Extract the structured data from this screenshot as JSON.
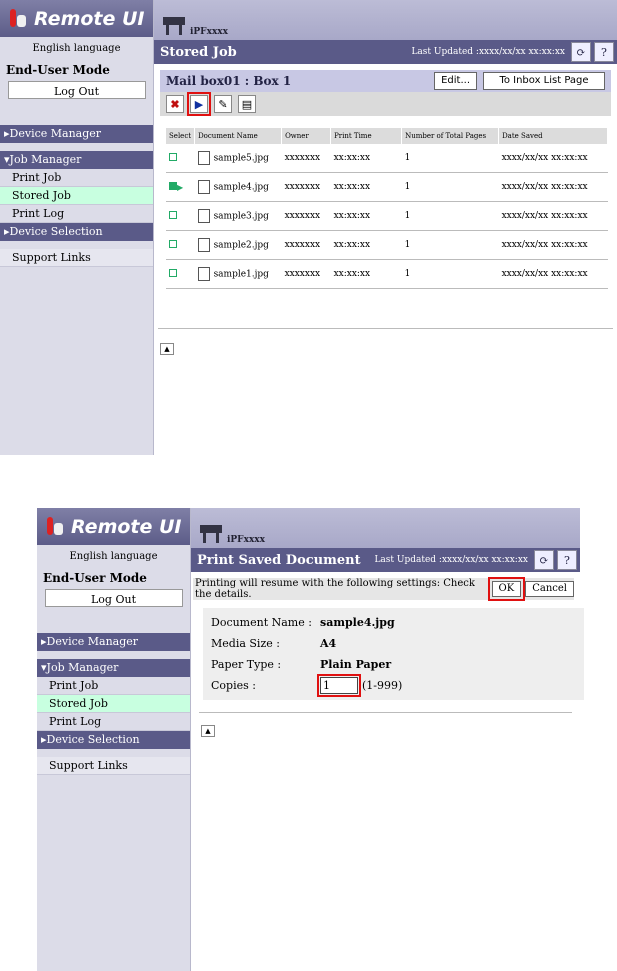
{
  "shot1": {
    "logo": "Remote UI",
    "language": "English language",
    "mode": "End-User Mode",
    "logout": "Log Out",
    "menu": {
      "device_manager": "Device Manager",
      "job_manager": "Job Manager",
      "print_job": "Print Job",
      "stored_job": "Stored Job",
      "print_log": "Print Log",
      "device_selection": "Device Selection",
      "support_links": "Support Links"
    },
    "printer": "iPFxxxx",
    "title": "Stored Job",
    "last_updated": "Last Updated :xxxx/xx/xx xx:xx:xx",
    "mailbox": "Mail box01 : Box 1",
    "edit": "Edit...",
    "to_inbox": "To Inbox List Page",
    "columns": [
      "Select",
      "Document Name",
      "Owner",
      "Print Time",
      "Number of Total Pages",
      "Date Saved"
    ],
    "rows": [
      {
        "doc": "sample5.jpg",
        "owner": "xxxxxxx",
        "time": "xx:xx:xx",
        "pages": "1",
        "date": "xxxx/xx/xx xx:xx:xx"
      },
      {
        "doc": "sample4.jpg",
        "owner": "xxxxxxx",
        "time": "xx:xx:xx",
        "pages": "1",
        "date": "xxxx/xx/xx xx:xx:xx"
      },
      {
        "doc": "sample3.jpg",
        "owner": "xxxxxxx",
        "time": "xx:xx:xx",
        "pages": "1",
        "date": "xxxx/xx/xx xx:xx:xx"
      },
      {
        "doc": "sample2.jpg",
        "owner": "xxxxxxx",
        "time": "xx:xx:xx",
        "pages": "1",
        "date": "xxxx/xx/xx xx:xx:xx"
      },
      {
        "doc": "sample1.jpg",
        "owner": "xxxxxxx",
        "time": "xx:xx:xx",
        "pages": "1",
        "date": "xxxx/xx/xx xx:xx:xx"
      }
    ]
  },
  "shot2": {
    "logo": "Remote UI",
    "language": "English language",
    "mode": "End-User Mode",
    "logout": "Log Out",
    "menu": {
      "device_manager": "Device Manager",
      "job_manager": "Job Manager",
      "print_job": "Print Job",
      "stored_job": "Stored Job",
      "print_log": "Print Log",
      "device_selection": "Device Selection",
      "support_links": "Support Links"
    },
    "printer": "iPFxxxx",
    "title": "Print Saved Document",
    "last_updated": "Last Updated :xxxx/xx/xx xx:xx:xx",
    "message": "Printing will resume with the following settings: Check the details.",
    "ok": "OK",
    "cancel": "Cancel",
    "doc_label": "Document Name :",
    "doc_value": "sample4.jpg",
    "media_label": "Media Size :",
    "media_value": "A4",
    "paper_label": "Paper Type :",
    "paper_value": "Plain Paper",
    "copies_label": "Copies :",
    "copies_value": "1",
    "copies_range": "(1-999)"
  },
  "colors": {
    "nav": "#5a5a88",
    "selected": "#c8ffe0",
    "highlight": "#e01010"
  }
}
